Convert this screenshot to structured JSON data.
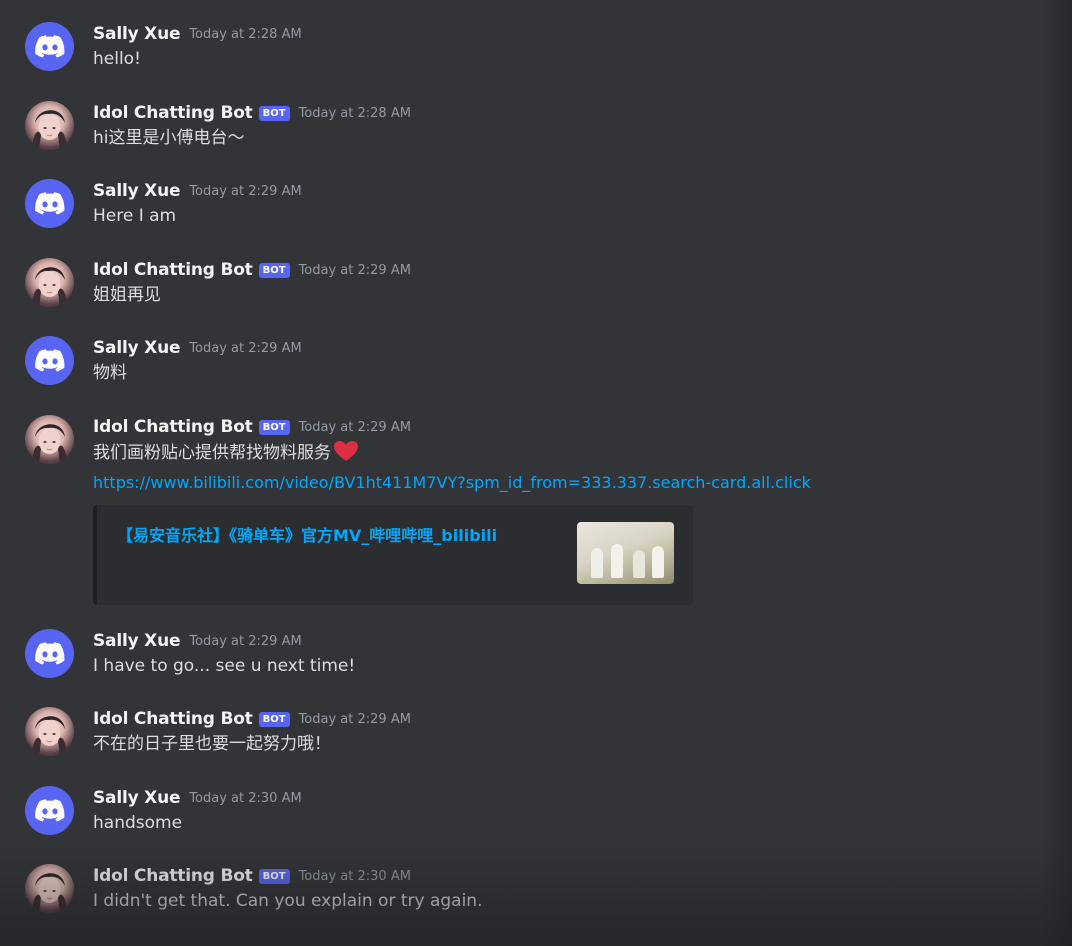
{
  "messages": [
    {
      "author": "Sally Xue",
      "type": "user",
      "time": "Today at 2:28 AM",
      "text": "hello!"
    },
    {
      "author": "Idol Chatting Bot",
      "type": "bot",
      "badge": "BOT",
      "time": "Today at 2:28 AM",
      "text": "hi这里是小傅电台～"
    },
    {
      "author": "Sally Xue",
      "type": "user",
      "time": "Today at 2:29 AM",
      "text": "Here I am"
    },
    {
      "author": "Idol Chatting Bot",
      "type": "bot",
      "badge": "BOT",
      "time": "Today at 2:29 AM",
      "text": "姐姐再见"
    },
    {
      "author": "Sally Xue",
      "type": "user",
      "time": "Today at 2:29 AM",
      "text": "物料"
    },
    {
      "author": "Idol Chatting Bot",
      "type": "bot",
      "badge": "BOT",
      "time": "Today at 2:29 AM",
      "text": "我们画粉贴心提供帮找物料服务",
      "emoji": "red-heart-icon",
      "link": "https://www.bilibili.com/video/BV1ht411M7VY?spm_id_from=333.337.search-card.all.click",
      "embed": {
        "title": "【易安音乐社】《骑单车》官方MV_哔哩哔哩_bilibili"
      }
    },
    {
      "author": "Sally Xue",
      "type": "user",
      "time": "Today at 2:29 AM",
      "text": "I have to go... see u next time!"
    },
    {
      "author": "Idol Chatting Bot",
      "type": "bot",
      "badge": "BOT",
      "time": "Today at 2:29 AM",
      "text": "不在的日子里也要一起努力哦！"
    },
    {
      "author": "Sally Xue",
      "type": "user",
      "time": "Today at 2:30 AM",
      "text": "handsome"
    },
    {
      "author": "Idol Chatting Bot",
      "type": "bot",
      "badge": "BOT",
      "time": "Today at 2:30 AM",
      "text": "I didn't get that. Can you explain or try again."
    }
  ],
  "colors": {
    "background": "#333438",
    "brand": "#5865f2",
    "link": "#00a8fc",
    "username": "#f2f3f5",
    "text": "#dbdee1",
    "timestamp": "#949ba4"
  }
}
